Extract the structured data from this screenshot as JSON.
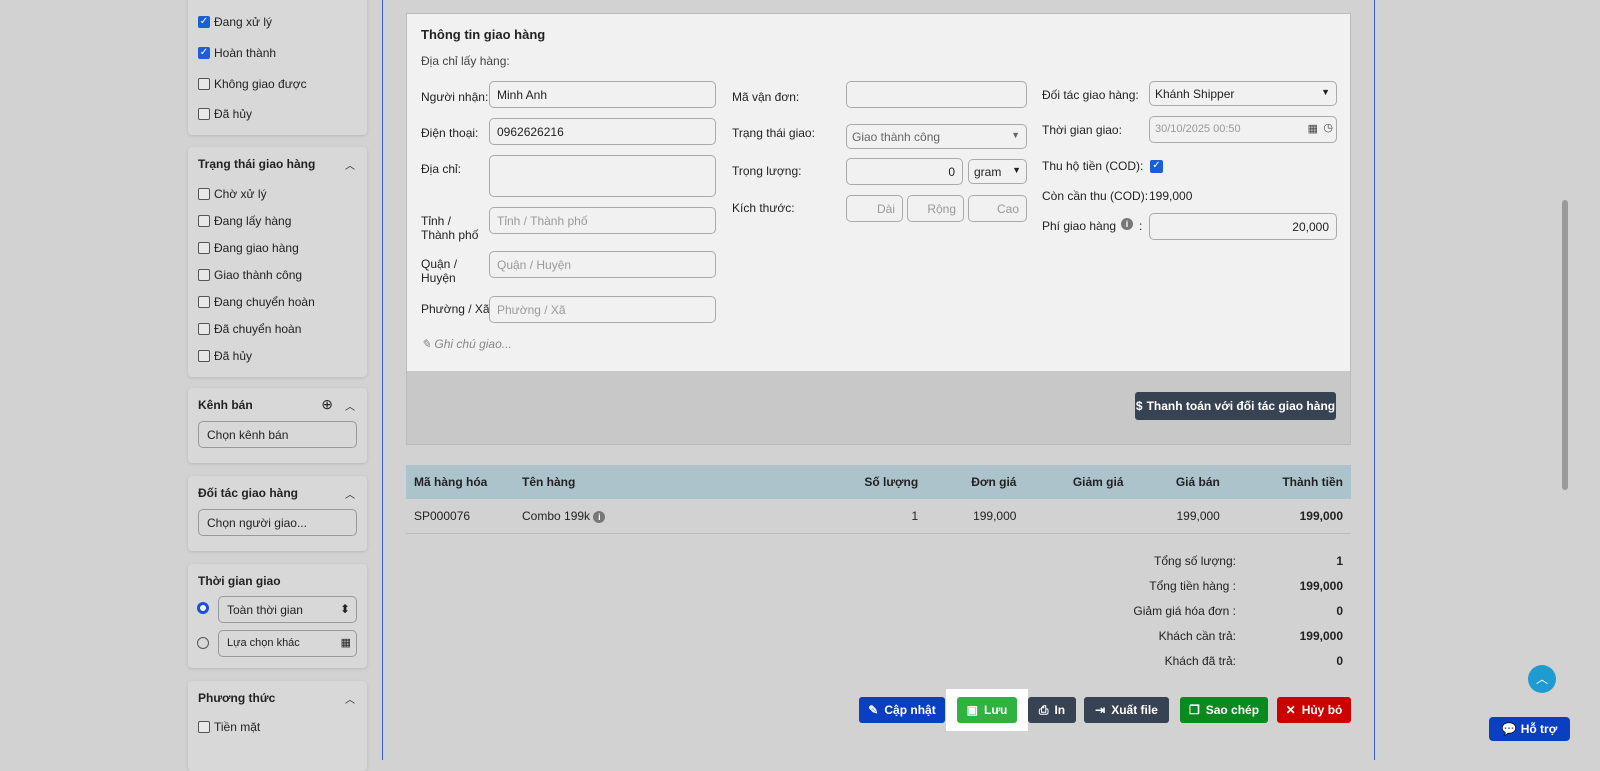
{
  "sidebar": {
    "status_items": [
      {
        "label": "Đang xử lý",
        "checked": true
      },
      {
        "label": "Hoàn thành",
        "checked": true
      },
      {
        "label": "Không giao được",
        "checked": false
      },
      {
        "label": "Đã hủy",
        "checked": false
      }
    ],
    "delivery_status": {
      "title": "Trạng thái giao hàng",
      "items": [
        "Chờ xử lý",
        "Đang lấy hàng",
        "Đang giao hàng",
        "Giao thành công",
        "Đang chuyển hoàn",
        "Đã chuyển hoàn",
        "Đã hủy"
      ]
    },
    "channel": {
      "title": "Kênh bán",
      "placeholder": "Chọn kênh bán"
    },
    "partner": {
      "title": "Đối tác giao hàng",
      "placeholder": "Chọn người giao..."
    },
    "time": {
      "title": "Thời gian giao",
      "option1": "Toàn thời gian",
      "option2": "Lựa chọn khác"
    },
    "method": {
      "title": "Phương thức",
      "items": [
        "Tiền mặt"
      ]
    }
  },
  "shipping": {
    "title": "Thông tin giao hàng",
    "pickup_label": "Địa chỉ lấy hàng:",
    "receiver_label": "Người nhận:",
    "receiver": "Minh Anh",
    "phone_label": "Điện thoại:",
    "phone": "0962626216",
    "address_label": "Địa chỉ:",
    "province_label": "Tỉnh / Thành phố",
    "province_ph": "Tỉnh / Thành phố",
    "district_label": "Quận / Huyện",
    "district_ph": "Quận / Huyện",
    "ward_label": "Phường / Xã",
    "ward_ph": "Phường / Xã",
    "note_ph": "Ghi chú giao...",
    "waybill_label": "Mã vận đơn:",
    "status_label": "Trạng thái giao:",
    "status": "Giao thành công",
    "weight_label": "Trọng lượng:",
    "weight": "0",
    "unit": "gram",
    "size_label": "Kích thước:",
    "length_ph": "Dài",
    "width_ph": "Rộng",
    "height_ph": "Cao",
    "partner_label": "Đối tác giao hàng:",
    "partner": "Khánh Shipper",
    "time_label": "Thời gian giao:",
    "time": "30/10/2025 00:50",
    "cod_label": "Thu hộ tiền (COD):",
    "remain_label": "Còn cần thu (COD):",
    "remain": "199,000",
    "fee_label": "Phí giao hàng",
    "fee_colon": ":",
    "fee": "20,000",
    "pay_button": "Thanh toán với đối tác giao hàng"
  },
  "table": {
    "headers": [
      "Mã hàng hóa",
      "Tên hàng",
      "Số lượng",
      "Đơn giá",
      "Giảm giá",
      "Giá bán",
      "Thành tiền"
    ],
    "rows": [
      {
        "code": "SP000076",
        "name": "Combo 199k",
        "qty": "1",
        "price": "199,000",
        "discount": "",
        "sale": "199,000",
        "total": "199,000"
      }
    ]
  },
  "summary": [
    {
      "label": "Tổng số lượng:",
      "value": "1"
    },
    {
      "label": "Tổng tiền hàng :",
      "value": "199,000"
    },
    {
      "label": "Giảm giá hóa đơn :",
      "value": "0"
    },
    {
      "label": "Khách cần trả:",
      "value": "199,000"
    },
    {
      "label": "Khách đã trả:",
      "value": "0"
    }
  ],
  "actions": {
    "update": "Cập nhật",
    "save": "Lưu",
    "print": "In",
    "export": "Xuất file",
    "copy": "Sao chép",
    "cancel": "Hủy bỏ"
  },
  "support": "Hỗ trợ"
}
